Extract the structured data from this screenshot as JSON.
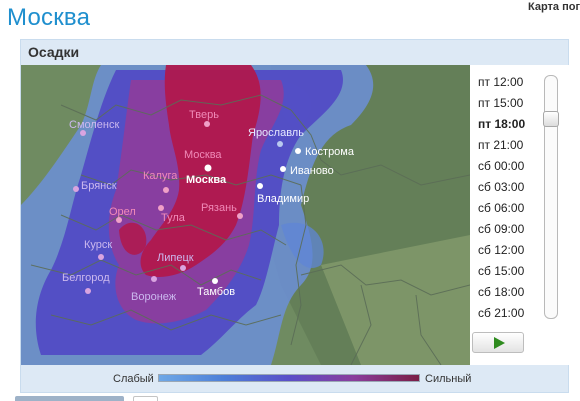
{
  "page": {
    "city_title": "Москва",
    "top_link": "Карта погоды"
  },
  "widget": {
    "title": "Осадки"
  },
  "map": {
    "cities": [
      {
        "name": "Смоленск",
        "style": "precip"
      },
      {
        "name": "Тверь",
        "style": "precip"
      },
      {
        "name": "Москва",
        "style": "precip"
      },
      {
        "name": "Москва",
        "style": "capital"
      },
      {
        "name": "Ярославль",
        "style": "dark"
      },
      {
        "name": "Кострома",
        "style": "white"
      },
      {
        "name": "Иваново",
        "style": "white"
      },
      {
        "name": "Брянск",
        "style": "precip"
      },
      {
        "name": "Калуга",
        "style": "precip"
      },
      {
        "name": "Владимир",
        "style": "white"
      },
      {
        "name": "Орел",
        "style": "precip"
      },
      {
        "name": "Тула",
        "style": "precip"
      },
      {
        "name": "Рязань",
        "style": "precip"
      },
      {
        "name": "Курск",
        "style": "precip"
      },
      {
        "name": "Липецк",
        "style": "precip"
      },
      {
        "name": "Белгород",
        "style": "precip"
      },
      {
        "name": "Воронеж",
        "style": "precip"
      },
      {
        "name": "Тамбов",
        "style": "white"
      }
    ]
  },
  "timeline": {
    "times": [
      "пт 12:00",
      "пт 15:00",
      "пт 18:00",
      "пт 21:00",
      "сб 00:00",
      "сб 03:00",
      "сб 06:00",
      "сб 09:00",
      "сб 12:00",
      "сб 15:00",
      "сб 18:00",
      "сб 21:00"
    ],
    "active_index": 2,
    "play_label": "play"
  },
  "legend": {
    "weak": "Слабый",
    "strong": "Сильный",
    "colors": [
      "#6fa8e6",
      "#4d7fd8",
      "#5a4fc8",
      "#8a3d9c",
      "#7a1e46"
    ]
  }
}
